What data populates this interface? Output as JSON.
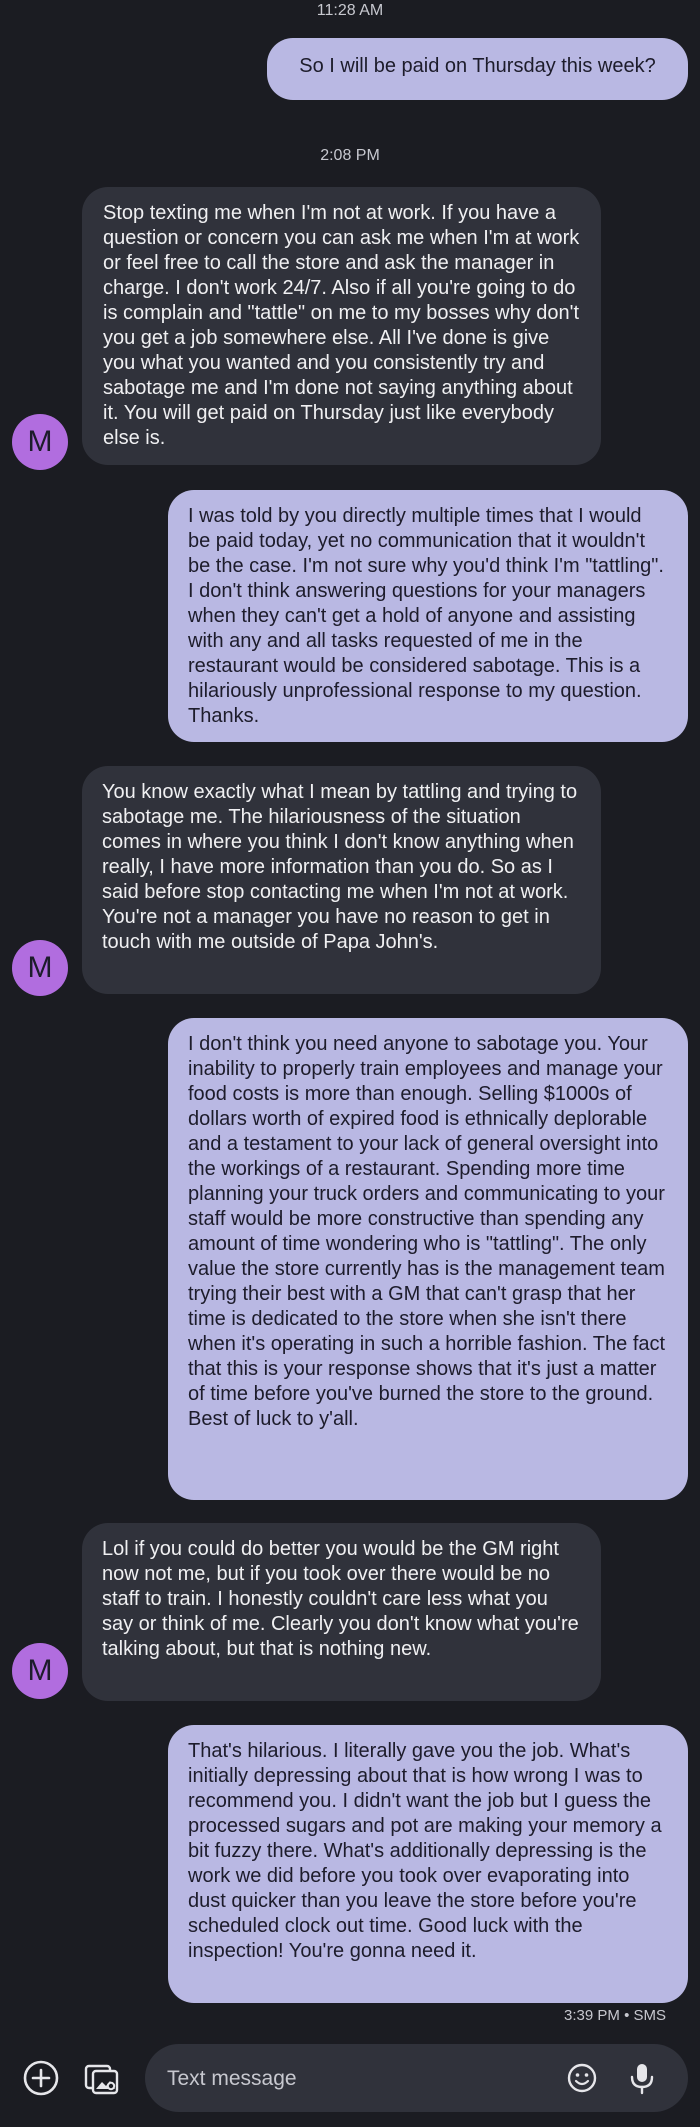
{
  "timestamps": {
    "first": "11:28 AM",
    "second": "2:08 PM"
  },
  "contact": {
    "avatar_initial": "M"
  },
  "messages": [
    {
      "dir": "out",
      "text": "So I will be paid on Thursday this week?"
    },
    {
      "dir": "in",
      "text": "Stop texting me when I'm not at work. If you have a question or concern you can ask me when I'm at work or feel free to call the store and ask the manager in charge. I don't work 24/7. Also if all you're going to do is complain and \"tattle\" on me to my bosses why don't you get a job somewhere else. All I've done is give you what you wanted and you consistently try and sabotage me and I'm done not saying anything about it. You will get paid on Thursday just like everybody else is."
    },
    {
      "dir": "out",
      "text": "I was told by you directly multiple times that I would be paid today, yet no communication that it wouldn't be the case. I'm not sure why you'd think I'm \"tattling\". I don't think answering questions for your managers when they can't get a hold of anyone and assisting with any and all tasks requested of me in the restaurant would be considered sabotage. This is a hilariously unprofessional response to my question. Thanks."
    },
    {
      "dir": "in",
      "text": "You know exactly what I mean by tattling and trying to sabotage me. The hilariousness of the situation comes in where you think I don't know anything when really, I have more information than you do. So as I said before stop contacting me when I'm not at work. You're not a manager you have no reason to get in touch with me outside of Papa John's."
    },
    {
      "dir": "out",
      "text": "I don't think you need anyone to sabotage you. Your inability to properly train employees and manage your food costs is more than enough. Selling $1000s of dollars worth of expired food is ethnically deplorable and a testament to your lack of general oversight into the workings of a restaurant. Spending more time planning your truck orders and communicating to your staff would be more constructive than spending any amount of time wondering who is \"tattling\". The only value the store currently has is the management team trying their best with a GM that can't grasp that her time is dedicated to the store when she isn't there when it's operating in such a horrible fashion. The fact that this is your response shows that it's just a matter of time before you've burned the store to the ground. Best of luck to y'all."
    },
    {
      "dir": "in",
      "text": "Lol if you could do better you would be the GM right now not me, but if you took over there would be no staff to train. I honestly couldn't care less what you say or think of me. Clearly you don't know what you're talking about, but that is nothing new."
    },
    {
      "dir": "out",
      "text": "That's hilarious. I literally gave you the job. What's initially depressing about that is how wrong I was to recommend you. I didn't want the job but I guess the processed sugars and pot are making your memory a bit fuzzy there. What's additionally depressing is the work we did before you took over evaporating into dust quicker than you leave the store before you're scheduled clock out time. Good luck with the inspection! You're gonna need it."
    }
  ],
  "status": {
    "text": "3:39 PM • SMS"
  },
  "compose": {
    "placeholder": "Text message",
    "icons": [
      "add-icon",
      "gallery-icon",
      "emoji-icon",
      "mic-icon"
    ]
  }
}
